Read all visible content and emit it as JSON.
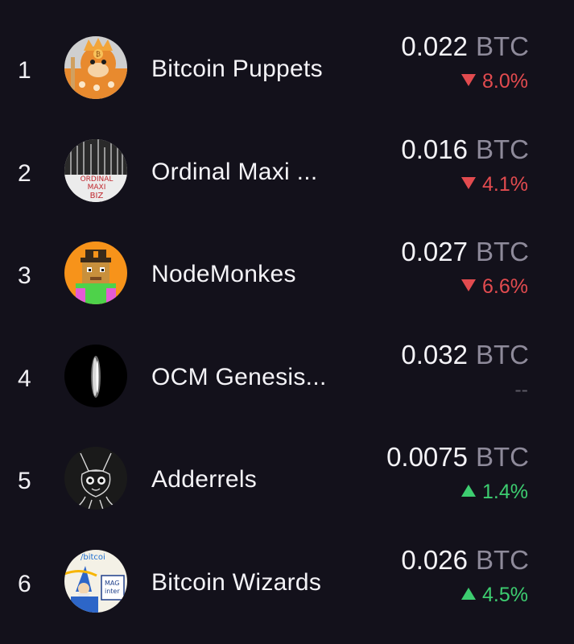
{
  "colors": {
    "background": "#13111b",
    "text": "#f4f3f7",
    "unit": "#8e8a9a",
    "down": "#e24b4f",
    "up": "#3dcd70",
    "neutral": "#5d5a66"
  },
  "collections": [
    {
      "rank": "1",
      "name": "Bitcoin Puppets",
      "price": "0.022",
      "unit": "BTC",
      "change": "8.0%",
      "direction": "down",
      "avatar": "bitcoin-puppets-avatar"
    },
    {
      "rank": "2",
      "name": "Ordinal Maxi ...",
      "price": "0.016",
      "unit": "BTC",
      "change": "4.1%",
      "direction": "down",
      "avatar": "ordinal-maxi-biz-avatar"
    },
    {
      "rank": "3",
      "name": "NodeMonkes",
      "price": "0.027",
      "unit": "BTC",
      "change": "6.6%",
      "direction": "down",
      "avatar": "nodemonkes-avatar"
    },
    {
      "rank": "4",
      "name": "OCM Genesis...",
      "price": "0.032",
      "unit": "BTC",
      "change": "--",
      "direction": "none",
      "avatar": "ocm-genesis-avatar"
    },
    {
      "rank": "5",
      "name": "Adderrels",
      "price": "0.0075",
      "unit": "BTC",
      "change": "1.4%",
      "direction": "up",
      "avatar": "adderrels-avatar"
    },
    {
      "rank": "6",
      "name": "Bitcoin Wizards",
      "price": "0.026",
      "unit": "BTC",
      "change": "4.5%",
      "direction": "up",
      "avatar": "bitcoin-wizards-avatar"
    }
  ],
  "avatar_text": {
    "ordinal_maxi": [
      "ORDINAL",
      "MAXI",
      "BIZ"
    ],
    "bitcoin_wizards": "/bitcoi",
    "bitcoin_wizards_sign": "MAG",
    "bitcoin_wizards_sign2": "inter"
  }
}
